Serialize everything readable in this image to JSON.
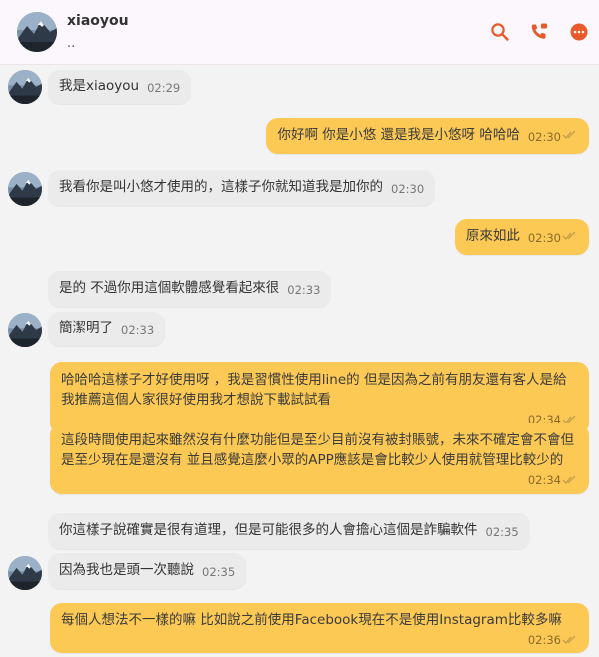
{
  "header": {
    "name": "xiaoyou",
    "status": "..",
    "colors": {
      "accent": "#e85a2a",
      "header_bg": "#fcf7fc"
    }
  },
  "messages": [
    {
      "side": "in",
      "text": "我是xiaoyou",
      "time": "02:29",
      "avatar": true
    },
    {
      "side": "out",
      "text": "你好啊 你是小悠 還是我是小悠呀 哈哈哈",
      "time": "02:30",
      "read": true
    },
    {
      "side": "in",
      "text": "我看你是叫小悠才使用的，這樣子你就知道我是加你的",
      "time": "02:30",
      "avatar": true
    },
    {
      "side": "out",
      "text": "原來如此",
      "time": "02:30",
      "read": true
    },
    {
      "side": "in",
      "text": "是的 不過你用這個軟體感覺看起來很",
      "time": "02:33",
      "avatar": false
    },
    {
      "side": "in",
      "text": "簡潔明了",
      "time": "02:33",
      "avatar": true
    },
    {
      "side": "out",
      "text": "哈哈哈這樣子才好使用呀 ，我是習慣性使用line的 但是因為之前有朋友還有客人是給我推薦這個人家很好使用我才想說下載試試看",
      "time": "02:34",
      "read": true
    },
    {
      "side": "out",
      "text": "這段時間使用起來雖然沒有什麼功能但是至少目前沒有被封賬號，未來不確定會不會但是至少現在是還沒有 並且感覺這麼小眾的APP應該是會比較少人使用就管理比較少的",
      "time": "02:34",
      "read": true
    },
    {
      "side": "in",
      "text": "你這樣子說確實是很有道理，但是可能很多的人會擔心這個是詐騙軟件",
      "time": "02:35",
      "avatar": false
    },
    {
      "side": "in",
      "text": "因為我也是頭一次聽說",
      "time": "02:35",
      "avatar": true
    },
    {
      "side": "out",
      "text": "每個人想法不一樣的嘛 比如說之前使用Facebook現在不是使用Instagram比較多嘛",
      "time": "02:36",
      "read": true
    }
  ]
}
